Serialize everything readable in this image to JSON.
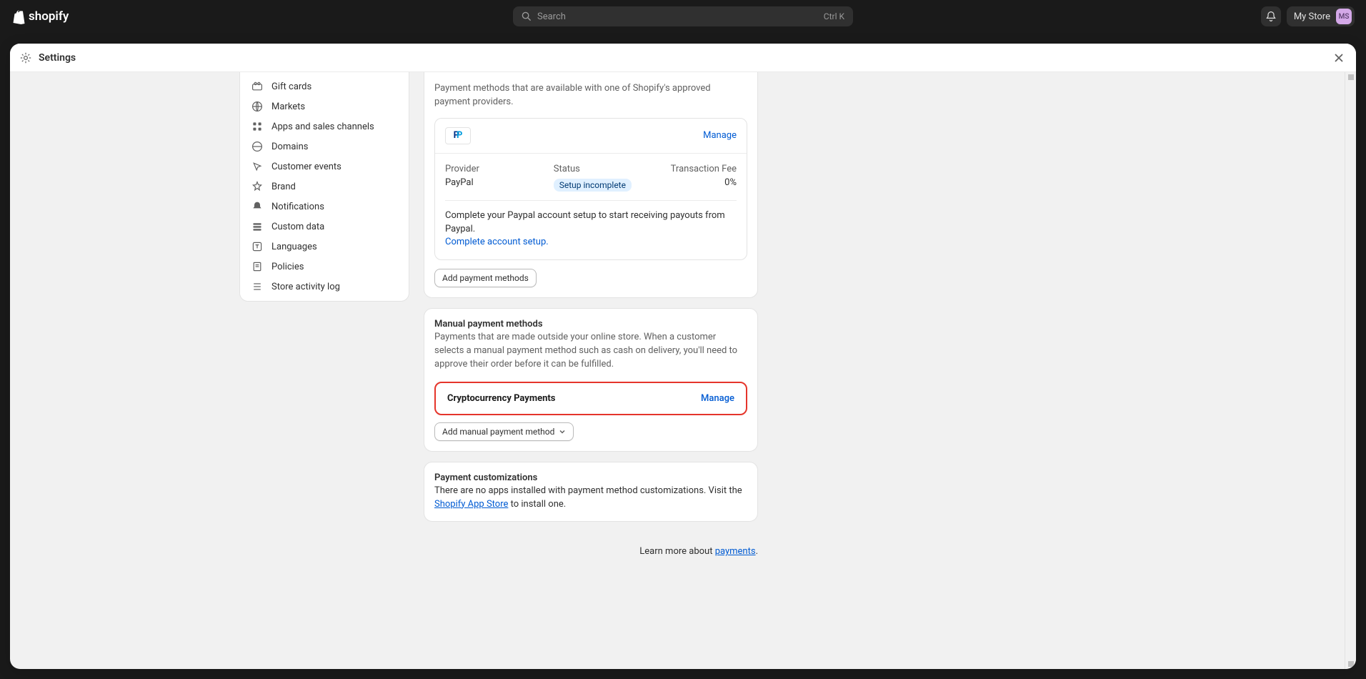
{
  "topbar": {
    "logo_text": "shopify",
    "search_placeholder": "Search",
    "search_kbd": "Ctrl K",
    "store_name": "My Store",
    "avatar_initials": "MS"
  },
  "modal": {
    "title": "Settings"
  },
  "sidebar": {
    "items": [
      {
        "label": "Gift cards",
        "icon": "gift-card-icon"
      },
      {
        "label": "Markets",
        "icon": "globe-icon"
      },
      {
        "label": "Apps and sales channels",
        "icon": "apps-icon"
      },
      {
        "label": "Domains",
        "icon": "domain-icon"
      },
      {
        "label": "Customer events",
        "icon": "cursor-icon"
      },
      {
        "label": "Brand",
        "icon": "brand-icon"
      },
      {
        "label": "Notifications",
        "icon": "bell-icon"
      },
      {
        "label": "Custom data",
        "icon": "data-icon"
      },
      {
        "label": "Languages",
        "icon": "language-icon"
      },
      {
        "label": "Policies",
        "icon": "policies-icon"
      },
      {
        "label": "Store activity log",
        "icon": "log-icon"
      }
    ]
  },
  "payments_card": {
    "description": "Payment methods that are available with one of Shopify's approved payment providers.",
    "manage_label": "Manage",
    "provider_label": "Provider",
    "provider_value": "PayPal",
    "status_label": "Status",
    "status_badge": "Setup incomplete",
    "fee_label": "Transaction Fee",
    "fee_value": "0%",
    "note_text": "Complete your Paypal account setup to start receiving payouts from Paypal.",
    "note_link": "Complete account setup.",
    "add_button": "Add payment methods"
  },
  "manual_card": {
    "heading": "Manual payment methods",
    "description": "Payments that are made outside your online store. When a customer selects a manual payment method such as cash on delivery, you'll need to approve their order before it can be fulfilled.",
    "crypto_title": "Cryptocurrency Payments",
    "crypto_manage": "Manage",
    "add_button": "Add manual payment method"
  },
  "customizations_card": {
    "heading": "Payment customizations",
    "text_part1": "There are no apps installed with payment method customizations. Visit the ",
    "link": "Shopify App Store",
    "text_part2": " to install one."
  },
  "learn_more": {
    "text": "Learn more about ",
    "link": "payments",
    "period": "."
  }
}
